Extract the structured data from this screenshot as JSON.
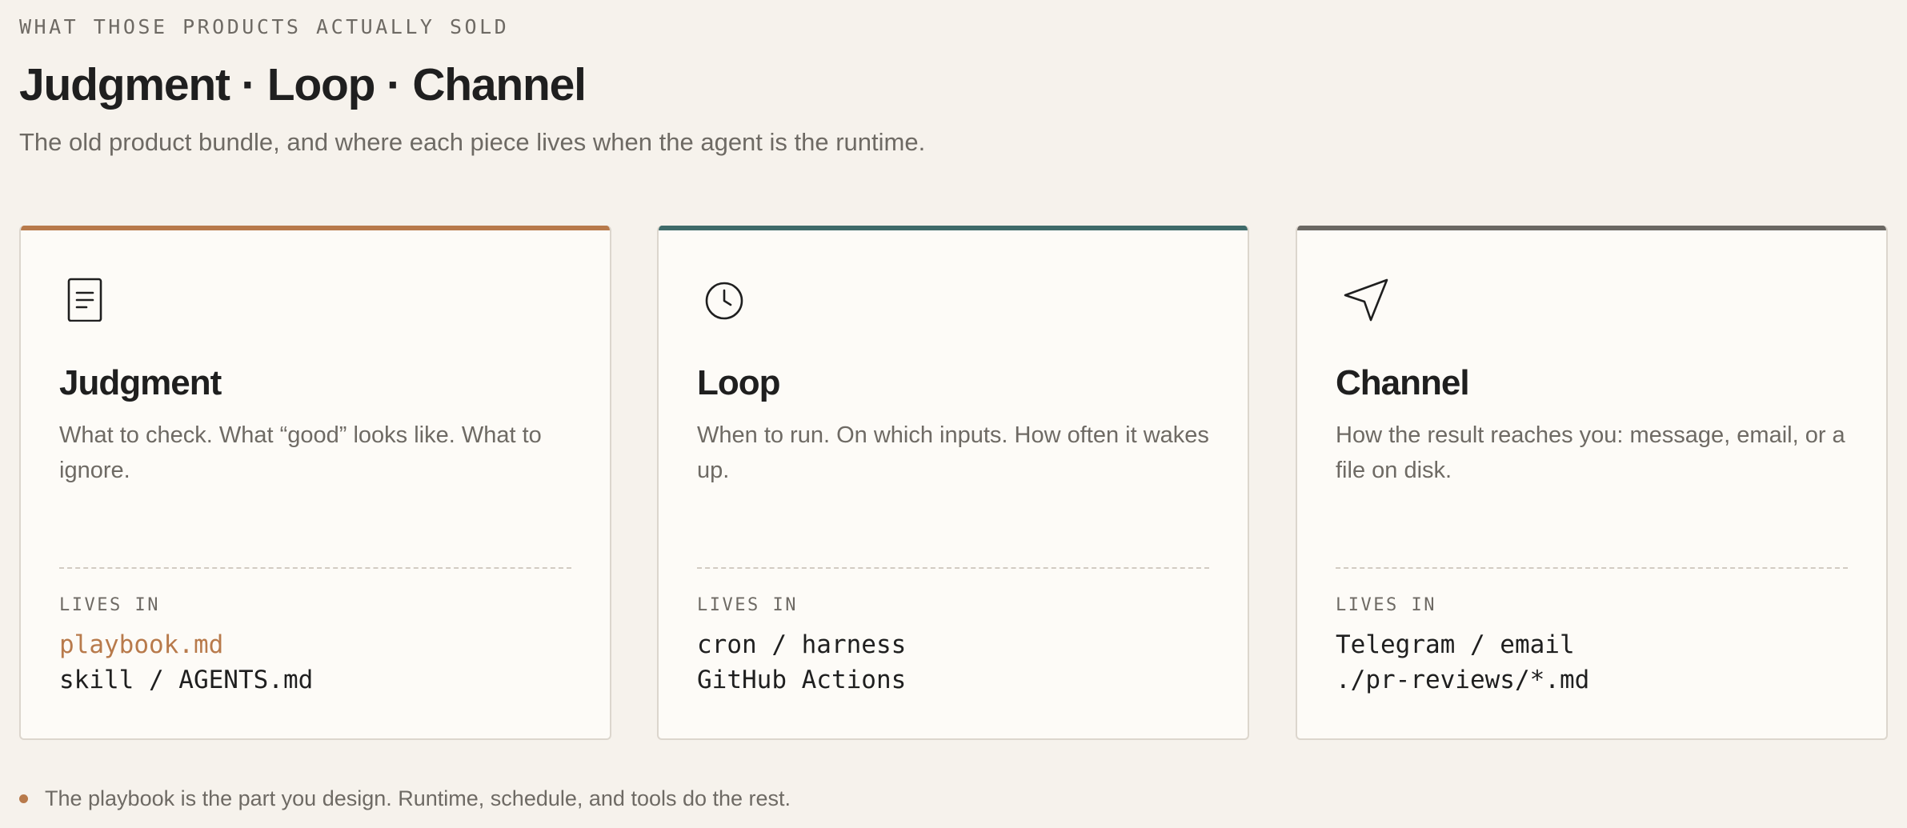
{
  "header": {
    "eyebrow": "WHAT THOSE PRODUCTS ACTUALLY SOLD",
    "title": "Judgment · Loop · Channel",
    "subtitle": "The old product bundle, and where each piece lives when the agent is the runtime."
  },
  "cards": [
    {
      "icon": "document-icon",
      "accent": "#b87a4b",
      "title": "Judgment",
      "description": "What to check. What “good” looks like. What to ignore.",
      "lives_in_label": "LIVES IN",
      "locations": [
        "playbook.md",
        "skill / AGENTS.md"
      ],
      "highlight_color": "#b87a4b"
    },
    {
      "icon": "clock-icon",
      "accent": "#3f6b6a",
      "title": "Loop",
      "description": "When to run. On which inputs. How often it wakes up.",
      "lives_in_label": "LIVES IN",
      "locations": [
        "cron / harness",
        "GitHub Actions"
      ]
    },
    {
      "icon": "send-icon",
      "accent": "#6b6863",
      "title": "Channel",
      "description": "How the result reaches you: message, email, or a file on disk.",
      "lives_in_label": "LIVES IN",
      "locations": [
        "Telegram / email",
        "./pr-reviews/*.md"
      ]
    }
  ],
  "footnote": {
    "text": "The playbook is the part you design. Runtime, schedule, and tools do the rest.",
    "bullet_color": "#b87a4b"
  },
  "colors": {
    "background": "#f6f2ec",
    "card_background": "#fdfbf7",
    "text_primary": "#1f1f1f",
    "text_muted": "#6e6a64"
  }
}
